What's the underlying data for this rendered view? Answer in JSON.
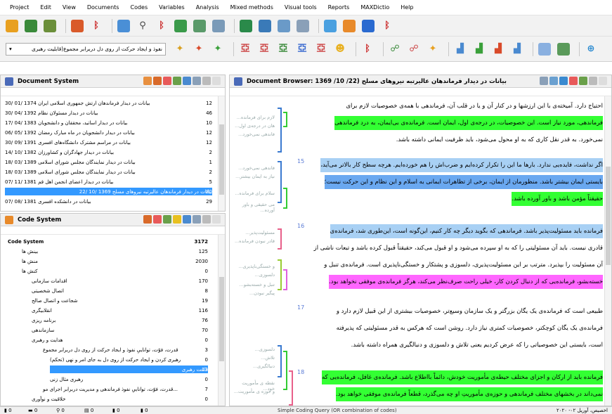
{
  "menu": [
    "Project",
    "Edit",
    "View",
    "Documents",
    "Codes",
    "Variables",
    "Analysis",
    "Mixed methods",
    "Visual tools",
    "Reports",
    "MAXDictio",
    "Help"
  ],
  "search_combo": "نفوذ و ایجاد حرکت از روی دل دربرابر مجموع(قابلیت رهبری",
  "doc_system": {
    "title": "Document System",
    "docs": [
      {
        "label": "بیانات در دیدار فرماندهان ارتش جمهوری اسلامی ایران 1374 /01 /30",
        "count": "12"
      },
      {
        "label": "بیانات در دیدار مسئولان نظام 1392 /04 /30",
        "count": "46"
      },
      {
        "label": "بیانات در دیدار اساتید، محققان و دانشجویان 1383 /04 /17",
        "count": "10"
      },
      {
        "label": "بیانات در دیدار دانشجویان در ماه مبارک رمضان 1392 /05 /06",
        "count": "12"
      },
      {
        "label": "بیانات در مراسم مشترک دانشگاه‌های افسری 1391 /09 /30",
        "count": "12"
      },
      {
        "label": "بیانات در دیدار جهادگران و کشاورزان 1382 /10 /14",
        "count": "2"
      },
      {
        "label": "بیانات در دیدار نمایندگان مجلس شورای اسلامی 1389 /03 /18",
        "count": "1"
      },
      {
        "label": "بیانات در دیدار نمایندگان مجلس شورای اسلامی 1389 /03 /18",
        "count": "2"
      },
      {
        "label": "بیانات در دیدار اعضای انجمن اهل قم 1381 /11 /07",
        "count": "5"
      },
      {
        "label": "بیانات در دیدار فرماندهان عالیرتبه نیروهای مسلح 1369 /10 /22",
        "count": "80"
      },
      {
        "label": "بیانات در دانشکده افسری 1381 /08 /07",
        "count": "29"
      }
    ]
  },
  "code_system": {
    "title": "Code System",
    "codes": [
      {
        "label": "Code System",
        "count": "3172"
      },
      {
        "label": "بینش ها",
        "count": "125"
      },
      {
        "label": "منش ها",
        "count": "2030"
      },
      {
        "label": "کنش ها",
        "count": "0"
      },
      {
        "label": "اقدامات سازمانی",
        "count": "170"
      },
      {
        "label": "اتصال شخصیتی",
        "count": "8"
      },
      {
        "label": "شجاعت و اتصال صالح",
        "count": "19"
      },
      {
        "label": "انقلابیگری",
        "count": "116"
      },
      {
        "label": "برنامه ریزی",
        "count": "76"
      },
      {
        "label": "سازماندهی",
        "count": "70"
      },
      {
        "label": "هدایت و رهبری",
        "count": "0"
      },
      {
        "label": "قدرت، فوّت، تواناییِ نفوذ و ایجاد حرکت از روی دل دربرابر مجموع",
        "count": "3"
      },
      {
        "label": "رهبری کردن و ایجاد حرکت از روی دل به جای امر و نهی (تحکم)",
        "count": "0"
      },
      {
        "label": "قاعت رهبری",
        "count": "13"
      },
      {
        "label": "رهبری مثال زنی",
        "count": "0"
      },
      {
        "label": "...قدرت، فوّت، تواناییِ نفوذ فرماندهی و مدیریت دربرابر اجرای مو",
        "count": "7"
      },
      {
        "label": "خلاقیت و نوآوری",
        "count": "0"
      }
    ]
  },
  "doc_browser": {
    "title": "Document Browser: 1369 /10 /22) بیانات در دیدار فرماندهان عالیرتبه نیروهای مسلح",
    "margin": [
      "لازم برای فرمانده...",
      "هان در درجه‌ی اول...",
      "فاندهی نمی‌خورد...",
      "فاندهی نمی‌خورد...",
      "نیاز به ایمان بیشتر...",
      "سلام برای فرمانده...",
      "می حقیقی و باور آورده...",
      "مسئولیت‌پذیر...",
      "قادر نبودن فرمانده...",
      "و خستگی‌ناپذیری...",
      "دلسوزی...",
      "تنبل و خسته‌بشو...",
      "پیگیر نبودن...",
      "دلسوزی...",
      "تلاش...",
      "دنبالگیری...",
      "نقطه ی مأموریت خود...",
      "و حوزه ی مأموریت..."
    ],
    "paragraph_numbers": [
      "15",
      "16",
      "17",
      "18"
    ],
    "lines": [
      "احتیاج دارد. آمیخته‌ی با این ارزشها و در کنار آن و یا در قلب آن، فرماندهی با همه‌ی خصوصیات لازم برای",
      "فرماندهی، مورد نیاز است. این خصوصیات، در درجه‌ی اول، ایمان است. فرمانده‌ی بی‌ایمان، به درد فرماندهی",
      "نمی‌خورد. به قدر نقل کاری که به او محول می‌شود، باید ظرفیت ایمانی داشته باشد.",
      "اگر نداشت، فایده‌یی ندارد. بارها ما این را تکرار کرده‌ایم و ضرب‌اش را هم خورده‌ایم. هرچه سطح کار بالاتر می‌آید،",
      "بایستی ایمان بیشتر باشد. منظورمان از ایمان، برخی از تظاهرات ایمانی به اسلام و این نظام و این حرکت نیست؛",
      "حقیقتاً مؤمن باشد و باور آورده باشد.",
      "فرمانده باید مسئولیت‌پذیر باشد. فرماندهی که بگوید دیگر چه کار کنیم، این‌گونه است، این‌طوری شد، فرمانده‌ی",
      "قادری نیست. باید آن مسئولیتی را که به او سپرده می‌شود و او قبول می‌کند، حقیقتاً قبول کرده باشد و تبعات ناشی از",
      "آن مسئولیت را بپذیرد. مترتب بر این مسئولیت‌پذیری، دلسوزی و پشتکار و خستگی‌ناپذیری است. فرمانده‌ی تنبل و",
      "خسته‌بشو، فرمانده‌یی که از دنبال کردن کار، خیلی راحت صرف‌نظر می‌کند، هرگز فرمانده‌ی موفقی نخواهد بود.",
      "طبیعی است که فرمانده‌ی یک یگان بزرگتر و یک سازمان وسیع‌تر، خصوصیات بیشتری از این قبیل لازم دارد و",
      "فرمانده‌ی یک یگان کوچکتر، خصوصیات کمتری نیاز دارد. روشن است که هرکس به قدر مسئولیتی که پذیرفته",
      "است، بایستی این خصوصیاتی را که عرض کردیم یعنی تلاش و دلسوزی و دنبالگیری همراه داشته باشد.",
      "فرمانده باید از ارکان و اجزای مختلف حیطه‌ی مأموریت خودش، دائماً بااطلاع باشد. فرمانده‌ی غافل، فرمانده‌یی که",
      "نمی‌داند در بخشهای مختلف فرماندهی و حوزه‌ی مأموریتِ او چه می‌گذرد، قطعاً فرمانده‌ی موفقی خواهد بود."
    ]
  },
  "status": {
    "items": [
      "0",
      "0",
      "0",
      "0",
      "0",
      "0"
    ],
    "query": "Simple Coding Query (OR combination of codes)",
    "user": "اخصیص، آوریل ۰۲- ۲۰۲۰"
  }
}
